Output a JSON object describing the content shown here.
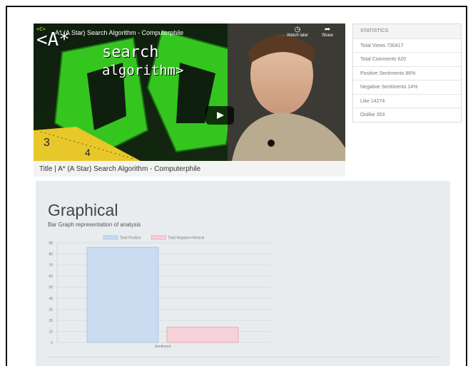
{
  "video": {
    "title": "A* (A Star) Search Algorithm - Computerphile",
    "logo": "<C>",
    "overlay_line1": "<A*",
    "overlay_line2": "search",
    "overlay_line3": "algorithm>",
    "watch_later_label": "Watch later",
    "share_label": "Share",
    "play_icon": "play-icon",
    "accent_color": "#3ddc23"
  },
  "title_line": "Title | A* (A Star) Search Algorithm - Computerphile",
  "stats": {
    "header": "STATISTICS",
    "items": [
      "Total Views 730417",
      "Total Comments 620",
      "Positive Sentiments 86%",
      "Negative Sentiments 14%",
      "Like 14274",
      "Dislike 353"
    ]
  },
  "panel": {
    "title": "Graphical",
    "subtitle": "Bar Graph representation of analysis"
  },
  "chart_data": {
    "type": "bar",
    "categories": [
      "Sentiment"
    ],
    "series": [
      {
        "name": "Total Positive",
        "values": [
          86
        ],
        "color": "#c9dcf0",
        "stroke": "#9ec3e6"
      },
      {
        "name": "Total Negative+Neutral",
        "values": [
          14
        ],
        "color": "#f6d2d9",
        "stroke": "#ec9fb0"
      }
    ],
    "xlabel": "",
    "ylabel": "",
    "ylim": [
      0,
      90
    ],
    "yticks": [
      0,
      10,
      20,
      30,
      40,
      50,
      60,
      70,
      80,
      90
    ],
    "grid": true,
    "legend": "top"
  }
}
